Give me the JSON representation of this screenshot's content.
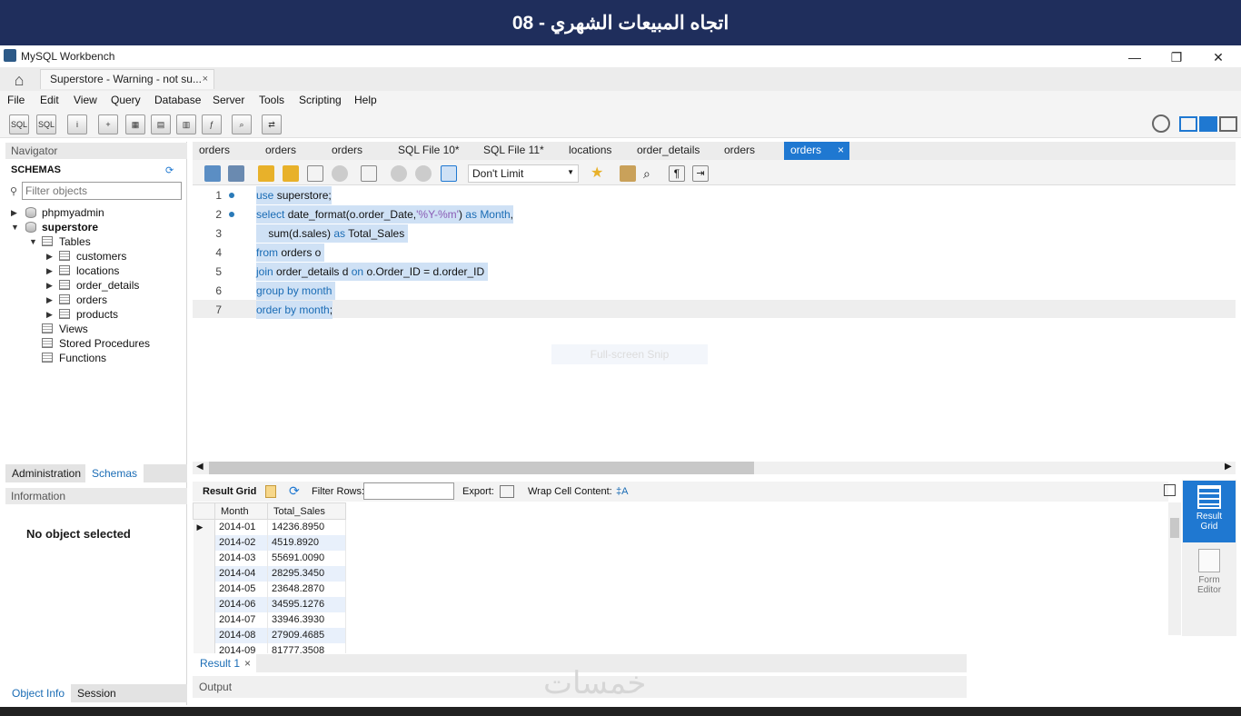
{
  "banner": {
    "title": "08 - اتجاه المبيعات الشهري"
  },
  "window": {
    "app_title": "MySQL Workbench",
    "minimize": "—",
    "restore": "❐",
    "close": "✕"
  },
  "connection_tab": {
    "label": "Superstore - Warning - not su...",
    "close": "×"
  },
  "menu": [
    "File",
    "Edit",
    "View",
    "Query",
    "Database",
    "Server",
    "Tools",
    "Scripting",
    "Help"
  ],
  "navigator": {
    "header": "Navigator",
    "schemas_label": "SCHEMAS",
    "filter_placeholder": "Filter objects",
    "schemas": [
      {
        "name": "phpmyadmin"
      },
      {
        "name": "superstore"
      }
    ],
    "tables_label": "Tables",
    "tables": [
      "customers",
      "locations",
      "order_details",
      "orders",
      "products"
    ],
    "views_label": "Views",
    "procedures_label": "Stored Procedures",
    "functions_label": "Functions"
  },
  "left_tabs": {
    "administration": "Administration",
    "schemas": "Schemas"
  },
  "information": {
    "header": "Information",
    "message": "No object selected"
  },
  "bottom_left_tabs": {
    "object_info": "Object Info",
    "session": "Session"
  },
  "editor_tabs": [
    "orders",
    "orders",
    "orders",
    "SQL File 10*",
    "SQL File 11*",
    "locations",
    "order_details",
    "orders",
    "orders"
  ],
  "editor_active_tab_close": "×",
  "limit_select": "Don't Limit",
  "snip_hint": "Full-screen Snip",
  "code_lines": [
    {
      "n": "1",
      "parts": [
        [
          "kw",
          "use"
        ],
        [
          "t",
          " superstore;"
        ]
      ]
    },
    {
      "n": "2",
      "parts": [
        [
          "kw",
          "select"
        ],
        [
          "t",
          " date_format(o.order_Date,"
        ],
        [
          "str",
          "'%Y-%m'"
        ],
        [
          "t",
          ") "
        ],
        [
          "kw",
          "as"
        ],
        [
          "t",
          " "
        ],
        [
          "kw",
          "Month"
        ],
        [
          "t",
          ","
        ]
      ]
    },
    {
      "n": "3",
      "parts": [
        [
          "t",
          "    sum(d.sales) "
        ],
        [
          "kw",
          "as"
        ],
        [
          "t",
          " Total_Sales "
        ]
      ]
    },
    {
      "n": "4",
      "parts": [
        [
          "kw",
          "from"
        ],
        [
          "t",
          " orders o "
        ]
      ]
    },
    {
      "n": "5",
      "parts": [
        [
          "kw",
          "join"
        ],
        [
          "t",
          " order_details d "
        ],
        [
          "kw",
          "on"
        ],
        [
          "t",
          " o.Order_ID = d.order_ID "
        ]
      ]
    },
    {
      "n": "6",
      "parts": [
        [
          "kw",
          "group by"
        ],
        [
          "t",
          " "
        ],
        [
          "kw",
          "month"
        ],
        [
          "t",
          " "
        ]
      ]
    },
    {
      "n": "7",
      "parts": [
        [
          "kw",
          "order by"
        ],
        [
          "t",
          " "
        ],
        [
          "kw",
          "month"
        ],
        [
          "t",
          ";"
        ]
      ]
    }
  ],
  "result_toolbar": {
    "result_grid": "Result Grid",
    "filter_rows": "Filter Rows:",
    "export": "Export:",
    "wrap": "Wrap Cell Content:",
    "wrap_icon": "‡A"
  },
  "grid": {
    "columns": [
      "Month",
      "Total_Sales"
    ],
    "rows": [
      [
        "2014-01",
        "14236.8950"
      ],
      [
        "2014-02",
        "4519.8920"
      ],
      [
        "2014-03",
        "55691.0090"
      ],
      [
        "2014-04",
        "28295.3450"
      ],
      [
        "2014-05",
        "23648.2870"
      ],
      [
        "2014-06",
        "34595.1276"
      ],
      [
        "2014-07",
        "33946.3930"
      ],
      [
        "2014-08",
        "27909.4685"
      ],
      [
        "2014-09",
        "81777.3508"
      ]
    ]
  },
  "right_panel": {
    "result_grid": "Result Grid",
    "form_editor": "Form Editor"
  },
  "result_tab": {
    "label": "Result 1",
    "close": "×"
  },
  "output": {
    "label": "Output"
  },
  "watermark": "خمسات",
  "colors": {
    "banner": "#1f2e5c",
    "accent": "#1f78d1",
    "selection": "#cfe1f5",
    "keyword": "#1a6cb5"
  }
}
